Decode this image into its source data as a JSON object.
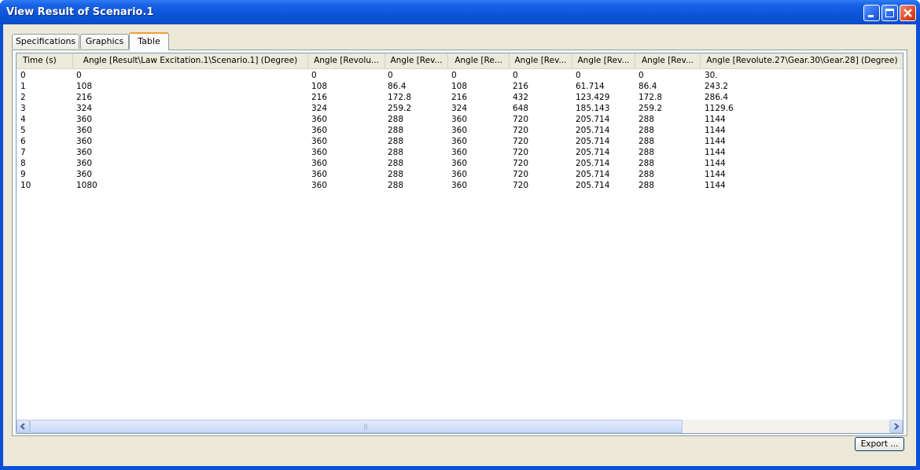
{
  "window": {
    "title": "View Result of Scenario.1"
  },
  "tabs": [
    {
      "label": "Specifications"
    },
    {
      "label": "Graphics"
    },
    {
      "label": "Table"
    }
  ],
  "table": {
    "columns": [
      "Time (s)",
      "Angle [Result\\Law Excitation.1\\Scenario.1] (Degree)",
      "Angle [Revolu...",
      "Angle [Rev...",
      "Angle [Re...",
      "Angle [Rev...",
      "Angle [Rev...",
      "Angle [Rev...",
      "Angle [Revolute.27\\Gear.30\\Gear.28] (Degree)"
    ],
    "rows": [
      [
        "0",
        "0",
        "0",
        "0",
        "0",
        "0",
        "0",
        "0",
        "30."
      ],
      [
        "1",
        "108",
        "108",
        "86.4",
        "108",
        "216",
        "61.714",
        "86.4",
        "243.2"
      ],
      [
        "2",
        "216",
        "216",
        "172.8",
        "216",
        "432",
        "123.429",
        "172.8",
        "286.4"
      ],
      [
        "3",
        "324",
        "324",
        "259.2",
        "324",
        "648",
        "185.143",
        "259.2",
        "1129.6"
      ],
      [
        "4",
        "360",
        "360",
        "288",
        "360",
        "720",
        "205.714",
        "288",
        "1144"
      ],
      [
        "5",
        "360",
        "360",
        "288",
        "360",
        "720",
        "205.714",
        "288",
        "1144"
      ],
      [
        "6",
        "360",
        "360",
        "288",
        "360",
        "720",
        "205.714",
        "288",
        "1144"
      ],
      [
        "7",
        "360",
        "360",
        "288",
        "360",
        "720",
        "205.714",
        "288",
        "1144"
      ],
      [
        "8",
        "360",
        "360",
        "288",
        "360",
        "720",
        "205.714",
        "288",
        "1144"
      ],
      [
        "9",
        "360",
        "360",
        "288",
        "360",
        "720",
        "205.714",
        "288",
        "1144"
      ],
      [
        "10",
        "1080",
        "360",
        "288",
        "360",
        "720",
        "205.714",
        "288",
        "1144"
      ]
    ]
  },
  "buttons": {
    "export": "Export ..."
  },
  "scrollbar": {
    "grip": "|||"
  },
  "icons": {
    "minimize": "minimize-icon",
    "maximize": "maximize-icon",
    "close": "close-icon",
    "scroll_left": "arrow-left-icon",
    "scroll_right": "arrow-right-icon"
  },
  "colors": {
    "titlebar": "#0a55d8",
    "client": "#ece9d8",
    "active_tab_accent": "#f0a030"
  }
}
